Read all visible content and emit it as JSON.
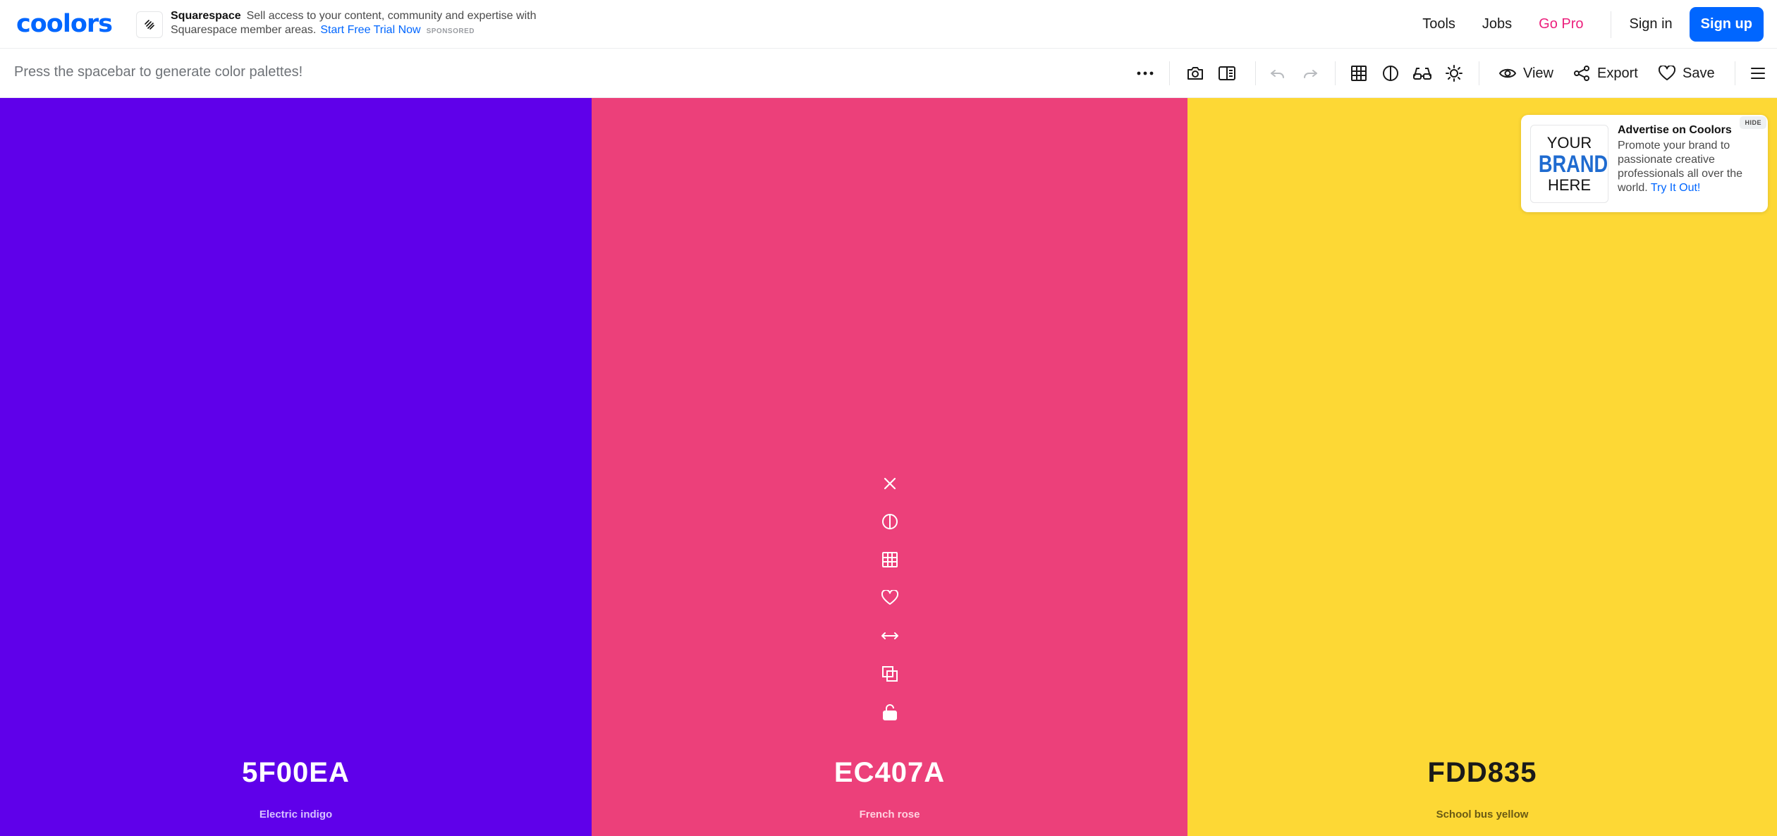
{
  "header": {
    "logo": "coolors",
    "sponsor": {
      "brand": "Squarespace",
      "text": "Sell access to your content, community and expertise with Squarespace member areas.",
      "cta": "Start Free Trial Now",
      "tag": "SPONSORED",
      "icon": "squarespace-logo-icon"
    },
    "nav": {
      "tools": "Tools",
      "jobs": "Jobs",
      "go_pro": "Go Pro",
      "sign_in": "Sign in",
      "sign_up": "Sign up"
    }
  },
  "toolbar": {
    "hint": "Press the spacebar to generate color palettes!",
    "icons": [
      "more-options-icon",
      "camera-icon",
      "book-icon",
      "undo-icon",
      "redo-icon",
      "grid-icon",
      "contrast-icon",
      "glasses-icon",
      "sun-icon",
      "eye-icon",
      "share-icon",
      "heart-icon",
      "menu-icon"
    ],
    "view_label": "View",
    "export_label": "Export",
    "save_label": "Save"
  },
  "palette": {
    "colors": [
      {
        "hex": "5F00EA",
        "name": "Electric indigo",
        "bg": "#5F00EA",
        "fg": "#ffffff",
        "sub": "#d7c2ff"
      },
      {
        "hex": "EC407A",
        "name": "French rose",
        "bg": "#EC407A",
        "fg": "#ffffff",
        "sub": "#ffd2e0"
      },
      {
        "hex": "FDD835",
        "name": "School bus yellow",
        "bg": "#FDD835",
        "fg": "#1a1a1a",
        "sub": "#6a5a14"
      }
    ],
    "column_tools": [
      "close-icon",
      "contrast-icon",
      "grid-icon",
      "heart-icon",
      "drag-arrows-icon",
      "copy-icon",
      "unlock-icon"
    ]
  },
  "ad": {
    "image_lines": [
      "YOUR",
      "BRAND",
      "HERE"
    ],
    "title": "Advertise on Coolors",
    "description": "Promote your brand to passionate creative professionals all over the world.",
    "link": "Try It Out!",
    "hide": "HIDE"
  }
}
